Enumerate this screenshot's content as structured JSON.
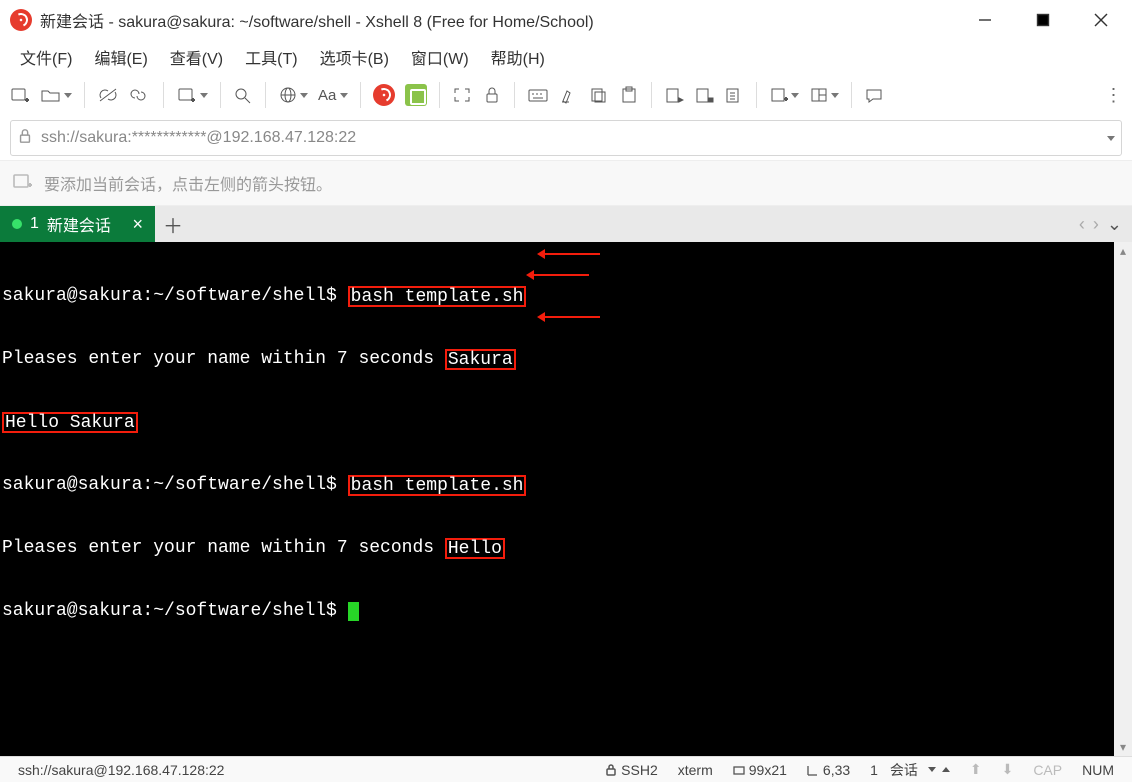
{
  "titlebar": {
    "title": "新建会话 - sakura@sakura: ~/software/shell - Xshell 8 (Free for Home/School)"
  },
  "menubar": {
    "items": [
      "文件(F)",
      "编辑(E)",
      "查看(V)",
      "工具(T)",
      "选项卡(B)",
      "窗口(W)",
      "帮助(H)"
    ]
  },
  "addressbar": {
    "url": "ssh://sakura:************@192.168.47.128:22"
  },
  "bookmarkbar": {
    "hint": "要添加当前会话，点击左侧的箭头按钮。"
  },
  "tabs": {
    "items": [
      {
        "index": "1",
        "label": "新建会话"
      }
    ]
  },
  "terminal": {
    "lines": [
      {
        "prompt": "sakura@sakura:~/software/shell$ ",
        "hl1": "bash template.sh"
      },
      {
        "text": "Pleases enter your name within 7 seconds ",
        "hl1": "Sakura"
      },
      {
        "hl1": "Hello Sakura"
      },
      {
        "prompt": "sakura@sakura:~/software/shell$ ",
        "hl1": "bash template.sh"
      },
      {
        "text": "Pleases enter your name within 7 seconds ",
        "hl1": "Hello"
      },
      {
        "prompt": "sakura@sakura:~/software/shell$ ",
        "cursor": true
      }
    ]
  },
  "statusbar": {
    "left": "ssh://sakura@192.168.47.128:22",
    "proto": "SSH2",
    "term": "xterm",
    "dims": "99x21",
    "cursor": "6,33",
    "sessions_label": "会话",
    "sessions_count": "1",
    "cap": "CAP",
    "num": "NUM"
  }
}
